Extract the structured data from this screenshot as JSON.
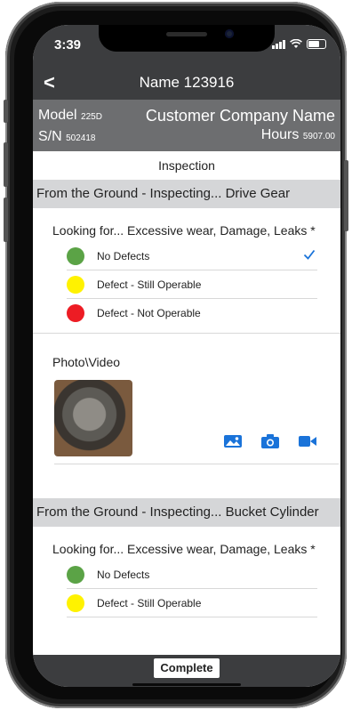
{
  "status_bar": {
    "time": "3:39"
  },
  "nav": {
    "back_label": "<",
    "title": "Name 123916"
  },
  "machine": {
    "model_label": "Model",
    "model_value": "225D",
    "sn_label": "S/N",
    "sn_value": "502418",
    "customer": "Customer Company Name",
    "hours_label": "Hours",
    "hours_value": "5907.00"
  },
  "section_title": "Inspection",
  "groups": [
    {
      "header": "From the Ground - Inspecting... Drive Gear",
      "question": "Looking for... Excessive wear, Damage, Leaks *",
      "options": [
        {
          "label": "No Defects",
          "color": "#5ba346",
          "selected": true
        },
        {
          "label": "Defect - Still Operable",
          "color": "#fff200",
          "selected": false
        },
        {
          "label": "Defect - Not Operable",
          "color": "#ed1c24",
          "selected": false
        }
      ],
      "photo_label": "Photo\\Video"
    },
    {
      "header": "From the Ground - Inspecting... Bucket Cylinder",
      "question": "Looking for... Excessive wear, Damage, Leaks *",
      "options": [
        {
          "label": "No Defects",
          "color": "#5ba346"
        },
        {
          "label": "Defect - Still Operable",
          "color": "#fff200"
        }
      ]
    }
  ],
  "media_icons": [
    "gallery-icon",
    "camera-icon",
    "video-icon"
  ],
  "accent_color": "#1a73d9",
  "complete_label": "Complete"
}
